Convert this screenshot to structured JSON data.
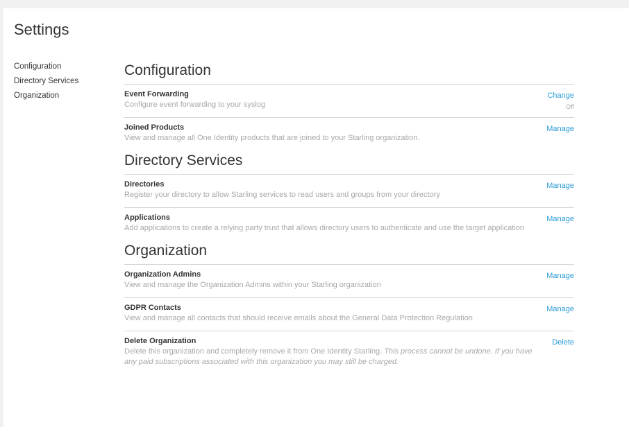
{
  "page": {
    "title": "Settings"
  },
  "side_nav": {
    "items": [
      {
        "label": "Configuration"
      },
      {
        "label": "Directory Services"
      },
      {
        "label": "Organization"
      }
    ]
  },
  "sections": {
    "configuration": {
      "title": "Configuration",
      "event_forwarding": {
        "title": "Event Forwarding",
        "desc": "Configure event forwarding to your syslog",
        "action": "Change",
        "status": "Off"
      },
      "joined_products": {
        "title": "Joined Products",
        "desc": "View and manage all One Identity products that are joined to your Starling organization.",
        "action": "Manage"
      }
    },
    "directory_services": {
      "title": "Directory Services",
      "directories": {
        "title": "Directories",
        "desc": "Register your directory to allow Starling services to read users and groups from your directory",
        "action": "Manage"
      },
      "applications": {
        "title": "Applications",
        "desc": "Add applications to create a relying party trust that allows directory users to authenticate and use the target application",
        "action": "Manage"
      }
    },
    "organization": {
      "title": "Organization",
      "org_admins": {
        "title": "Organization Admins",
        "desc": "View and manage the Organization Admins within your Starling organization",
        "action": "Manage"
      },
      "gdpr_contacts": {
        "title": "GDPR Contacts",
        "desc": "View and manage all contacts that should receive emails about the General Data Protection Regulation",
        "action": "Manage"
      },
      "delete_org": {
        "title": "Delete Organization",
        "desc": "Delete this organization and completely remove it from One Identity Starling.",
        "desc_warning": "This process cannot be undone. If you have any paid subscriptions associated with this organization you may still be charged.",
        "action": "Delete"
      }
    }
  },
  "colors": {
    "link": "#2b9bd6",
    "muted_text": "#a8a8a8",
    "body_text": "#333333",
    "page_background": "#f1f1f2"
  }
}
